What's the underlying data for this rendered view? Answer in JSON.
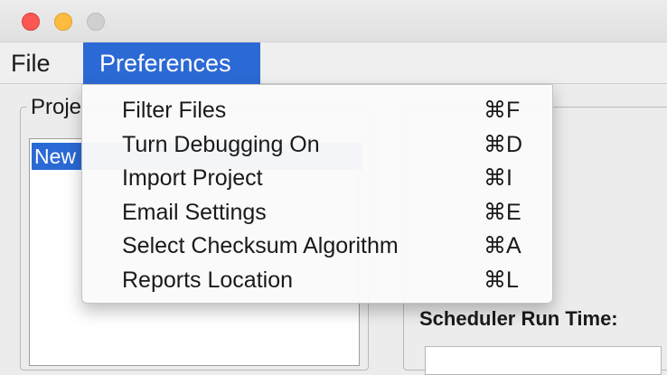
{
  "menubar": {
    "file_label": "File",
    "preferences_label": "Preferences"
  },
  "preferences_menu": {
    "items": [
      {
        "label": "Filter Files",
        "shortcut": "⌘F"
      },
      {
        "label": "Turn Debugging On",
        "shortcut": "⌘D"
      },
      {
        "label": "Import Project",
        "shortcut": "⌘I"
      },
      {
        "label": "Email Settings",
        "shortcut": "⌘E"
      },
      {
        "label": "Select Checksum Algorithm",
        "shortcut": "⌘A"
      },
      {
        "label": "Reports Location",
        "shortcut": "⌘L"
      }
    ]
  },
  "projects_panel": {
    "label_visible": "Proje",
    "selected_item_visible": "New"
  },
  "schedule_panel": {
    "scheduler_time_label": "Scheduler Run Time:"
  },
  "colors": {
    "menu_highlight": "#2b69d5",
    "close_button": "#fc5753",
    "minimize_button": "#fdbc40",
    "maximize_button": "#d0d0d0"
  }
}
